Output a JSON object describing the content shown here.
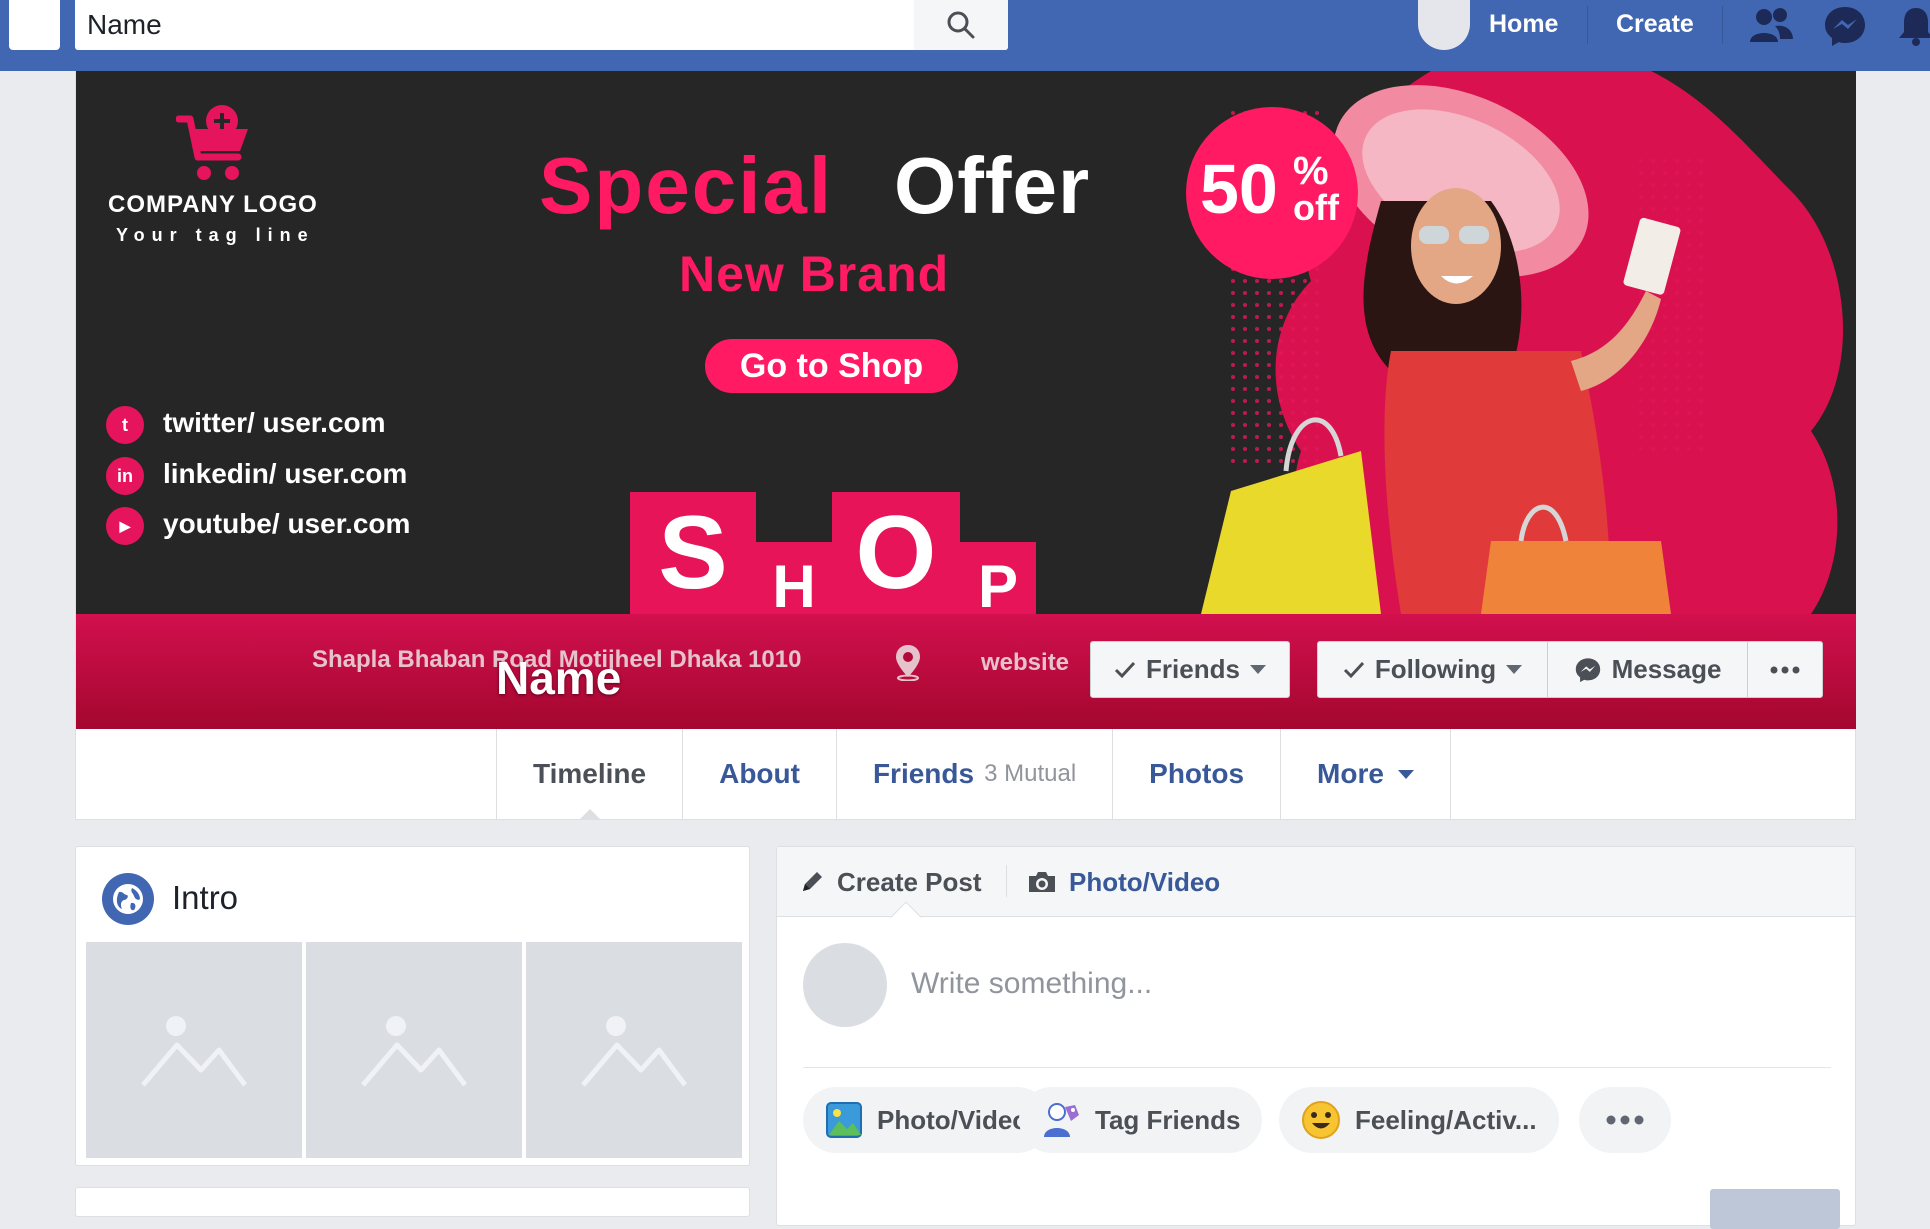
{
  "topbar": {
    "search_value": "Name",
    "nav": {
      "home": "Home",
      "create": "Create"
    }
  },
  "cover": {
    "logo_text": "COMPANY LOGO",
    "logo_tagline": "Your tag line",
    "headline_part1": "Special",
    "headline_part2": "Offer",
    "subheadline": "New Brand",
    "cta": "Go to Shop",
    "discount": {
      "value": "50",
      "percent": "%",
      "off": "off"
    },
    "shop_letters": [
      "S",
      "H",
      "O",
      "P"
    ],
    "social": [
      {
        "icon": "twitter-icon",
        "glyph": "t",
        "text": "twitter/ user.com"
      },
      {
        "icon": "linkedin-icon",
        "glyph": "in",
        "text": "linkedin/ user.com"
      },
      {
        "icon": "youtube-icon",
        "glyph": "▶",
        "text": "youtube/ user.com"
      }
    ],
    "address": "Shapla Bhaban Road Motijheel Dhaka 1010",
    "website": "website"
  },
  "profile": {
    "name": "Name",
    "buttons": {
      "friends": "Friends",
      "following": "Following",
      "message": "Message"
    },
    "tabs": [
      {
        "label": "Timeline",
        "count": ""
      },
      {
        "label": "About",
        "count": ""
      },
      {
        "label": "Friends",
        "count": "3 Mutual"
      },
      {
        "label": "Photos",
        "count": ""
      },
      {
        "label": "More",
        "count": ""
      }
    ]
  },
  "intro": {
    "title": "Intro"
  },
  "composer": {
    "create_post": "Create Post",
    "photo_video": "Photo/Video",
    "placeholder": "Write something...",
    "chips": {
      "photo": "Photo/Video",
      "tag": "Tag Friends",
      "feeling": "Feeling/Activ..."
    }
  },
  "colors": {
    "facebook_blue": "#4267b2",
    "accent_pink": "#ff1a63",
    "cover_dark": "#262626",
    "link_blue": "#385898"
  }
}
